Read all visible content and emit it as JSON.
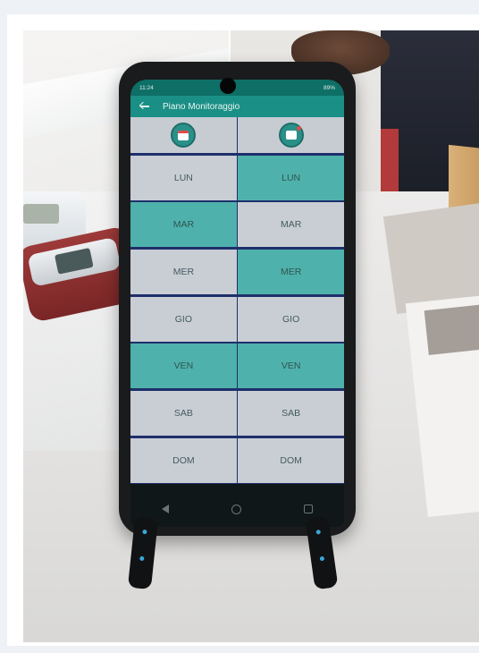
{
  "phone": {
    "status": {
      "time": "11:24",
      "battery": "89%"
    },
    "app_bar": {
      "title": "Piano Monitoraggio"
    },
    "columns": [
      {
        "icon": "calendar-icon"
      },
      {
        "icon": "blood-pressure-icon"
      }
    ],
    "days": [
      {
        "label": "LUN",
        "col1_active": false,
        "col2_active": true
      },
      {
        "label": "MAR",
        "col1_active": true,
        "col2_active": false
      },
      {
        "label": "MER",
        "col1_active": false,
        "col2_active": true
      },
      {
        "label": "GIO",
        "col1_active": false,
        "col2_active": false
      },
      {
        "label": "VEN",
        "col1_active": true,
        "col2_active": true
      },
      {
        "label": "SAB",
        "col1_active": false,
        "col2_active": false
      },
      {
        "label": "DOM",
        "col1_active": false,
        "col2_active": false
      }
    ]
  },
  "colors": {
    "app_bar": "#1a8f85",
    "active_cell": "#4fb1ab",
    "inactive_cell": "#c9ced5",
    "grid_lines": "#1e2f6b"
  }
}
